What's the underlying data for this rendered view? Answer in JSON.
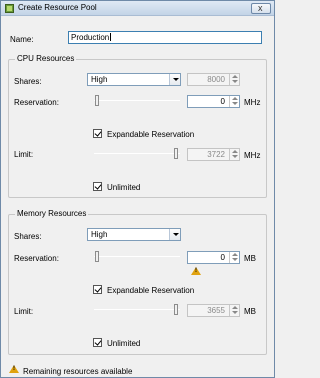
{
  "window": {
    "title": "Create Resource Pool",
    "close_glyph": "x"
  },
  "name_field": {
    "label": "Name:",
    "value": "Production"
  },
  "cpu": {
    "group_title": "CPU Resources",
    "shares_label": "Shares:",
    "shares_value": "High",
    "shares_number": "8000",
    "reservation_label": "Reservation:",
    "reservation_value": "0",
    "reservation_unit": "MHz",
    "expandable_label": "Expandable Reservation",
    "expandable_checked": true,
    "limit_label": "Limit:",
    "limit_value": "3722",
    "limit_unit": "MHz",
    "unlimited_label": "Unlimited",
    "unlimited_checked": true
  },
  "memory": {
    "group_title": "Memory Resources",
    "shares_label": "Shares:",
    "shares_value": "High",
    "reservation_label": "Reservation:",
    "reservation_value": "0",
    "reservation_unit": "MB",
    "expandable_label": "Expandable Reservation",
    "expandable_checked": true,
    "limit_label": "Limit:",
    "limit_value": "3655",
    "limit_unit": "MB",
    "unlimited_label": "Unlimited",
    "unlimited_checked": true
  },
  "footer": {
    "warning_text": "Remaining resources available"
  },
  "colors": {
    "warning": "#e0a20f",
    "title_bar": "#c3d4e7"
  },
  "icons": {
    "title": "resource-pool-icon",
    "warning": "warning-icon"
  }
}
